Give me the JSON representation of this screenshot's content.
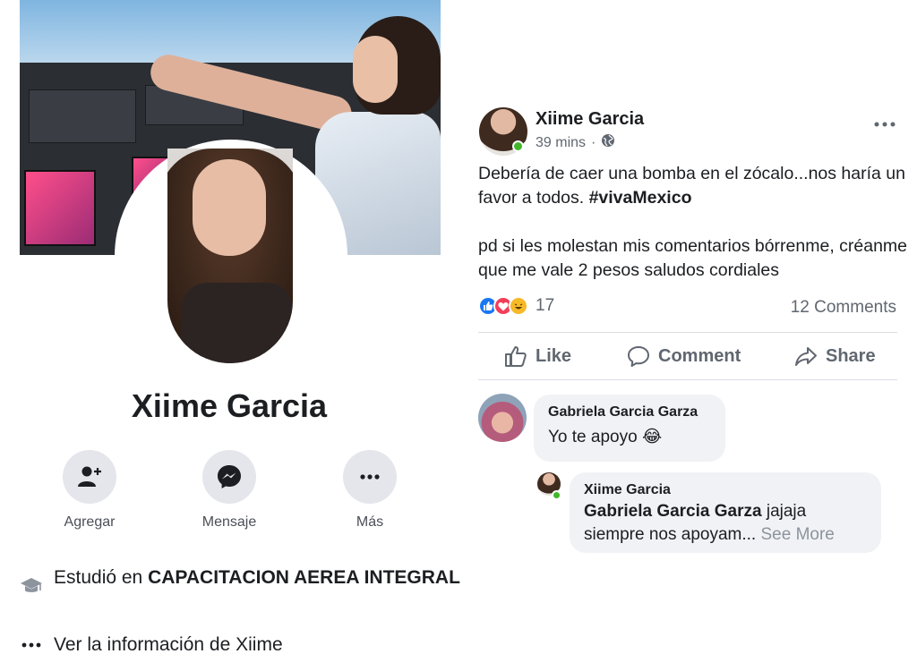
{
  "profile": {
    "name": "Xiime Garcia",
    "actions": [
      {
        "label": "Agregar",
        "icon": "add-friend-icon"
      },
      {
        "label": "Mensaje",
        "icon": "messenger-icon"
      },
      {
        "label": "Más",
        "icon": "more-icon"
      }
    ],
    "education_prefix": "Estudió en ",
    "education_school": "CAPACITACION AEREA INTEGRAL",
    "about_link": "Ver la información de Xiime"
  },
  "post": {
    "author": "Xiime Garcia",
    "time": "39 mins",
    "separator": "·",
    "audience_icon": "globe-icon",
    "text_line1": "Debería de caer una bomba en el zócalo...nos haría un favor a todos. ",
    "hashtag": "#vivaMexico",
    "text_line2": "pd si les molestan mis comentarios bórrenme, créanme que me vale 2 pesos  saludos cordiales",
    "reaction_count": "17",
    "comments_count": "12 Comments",
    "buttons": {
      "like": "Like",
      "comment": "Comment",
      "share": "Share"
    },
    "colors": {
      "like": "#1877f2",
      "love": "#f33e58",
      "haha": "#f7b928",
      "online": "#42b72a"
    }
  },
  "comments": [
    {
      "author": "Gabriela Garcia Garza",
      "text": "Yo te apoyo",
      "emoji": "😂"
    },
    {
      "author": "Xiime Garcia",
      "mention": "Gabriela Garcia Garza",
      "text": " jajaja siempre nos apoyam... ",
      "see_more": "See More"
    }
  ]
}
